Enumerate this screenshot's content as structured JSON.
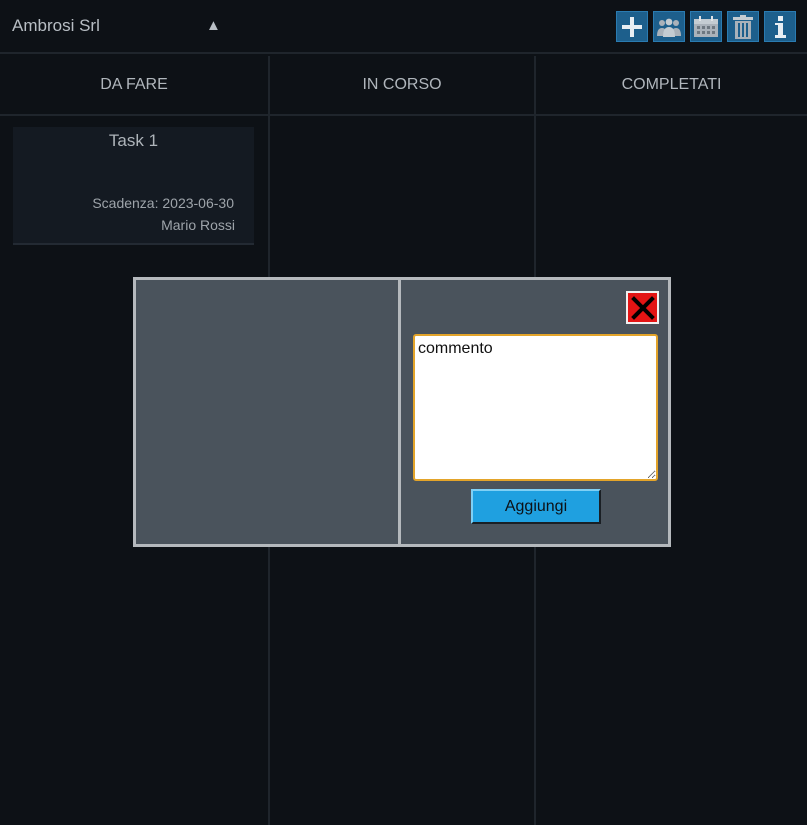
{
  "header": {
    "company": "Ambrosi Srl",
    "caret": "▲",
    "tools": [
      {
        "icon": "plus-icon"
      },
      {
        "icon": "users-icon"
      },
      {
        "icon": "calendar-icon"
      },
      {
        "icon": "trash-icon"
      },
      {
        "icon": "info-icon"
      }
    ]
  },
  "columns": [
    {
      "title": "DA FARE"
    },
    {
      "title": "IN CORSO"
    },
    {
      "title": "COMPLETATI"
    }
  ],
  "card": {
    "title": "Task 1",
    "due": "Scadenza: 2023-06-30",
    "assignee": "Mario Rossi"
  },
  "modal": {
    "comment_value": "commento",
    "add_label": "Aggiungi"
  },
  "colors": {
    "background": "#0d1116",
    "accent": "#1fa0e0",
    "close": "#e31414",
    "focus_border": "#e3a42a"
  }
}
